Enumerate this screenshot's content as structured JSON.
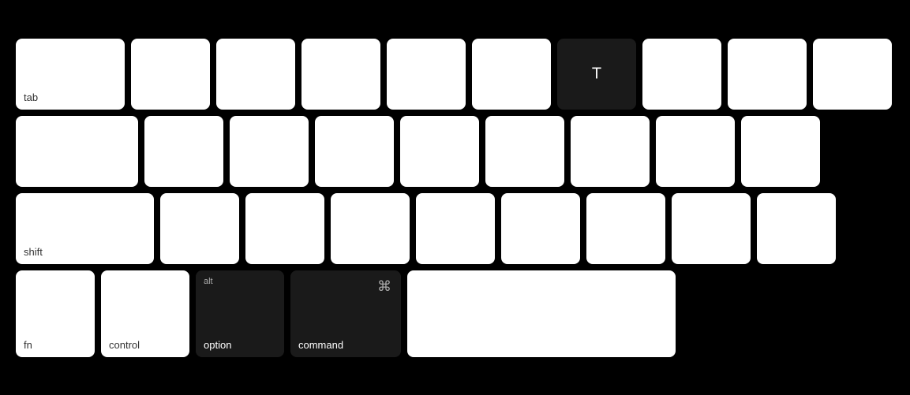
{
  "keyboard": {
    "rows": [
      {
        "id": "row1",
        "keys": [
          {
            "id": "tab",
            "label": "tab",
            "variant": "light",
            "size": "tab"
          },
          {
            "id": "r1k2",
            "label": "",
            "variant": "light",
            "size": "normal"
          },
          {
            "id": "r1k3",
            "label": "",
            "variant": "light",
            "size": "normal"
          },
          {
            "id": "r1k4",
            "label": "",
            "variant": "light",
            "size": "normal"
          },
          {
            "id": "r1k5",
            "label": "",
            "variant": "light",
            "size": "normal"
          },
          {
            "id": "r1k6",
            "label": "",
            "variant": "light",
            "size": "normal"
          },
          {
            "id": "T",
            "label": "T",
            "variant": "dark",
            "size": "normal"
          },
          {
            "id": "r1k8",
            "label": "",
            "variant": "light",
            "size": "normal"
          },
          {
            "id": "r1k9",
            "label": "",
            "variant": "light",
            "size": "normal"
          },
          {
            "id": "r1k10",
            "label": "",
            "variant": "light",
            "size": "normal"
          }
        ]
      },
      {
        "id": "row2",
        "keys": [
          {
            "id": "caps",
            "label": "",
            "variant": "light",
            "size": "caps"
          },
          {
            "id": "r2k2",
            "label": "",
            "variant": "light",
            "size": "normal"
          },
          {
            "id": "r2k3",
            "label": "",
            "variant": "light",
            "size": "normal"
          },
          {
            "id": "r2k4",
            "label": "",
            "variant": "light",
            "size": "normal"
          },
          {
            "id": "r2k5",
            "label": "",
            "variant": "light",
            "size": "normal"
          },
          {
            "id": "r2k6",
            "label": "",
            "variant": "light",
            "size": "normal"
          },
          {
            "id": "r2k7",
            "label": "",
            "variant": "light",
            "size": "normal"
          },
          {
            "id": "r2k8",
            "label": "",
            "variant": "light",
            "size": "normal"
          },
          {
            "id": "r2k9",
            "label": "",
            "variant": "light",
            "size": "normal"
          }
        ]
      },
      {
        "id": "row3",
        "keys": [
          {
            "id": "shift",
            "label": "shift",
            "variant": "light",
            "size": "shift"
          },
          {
            "id": "r3k2",
            "label": "",
            "variant": "light",
            "size": "normal"
          },
          {
            "id": "r3k3",
            "label": "",
            "variant": "light",
            "size": "normal"
          },
          {
            "id": "r3k4",
            "label": "",
            "variant": "light",
            "size": "normal"
          },
          {
            "id": "r3k5",
            "label": "",
            "variant": "light",
            "size": "normal"
          },
          {
            "id": "r3k6",
            "label": "",
            "variant": "light",
            "size": "normal"
          },
          {
            "id": "r3k7",
            "label": "",
            "variant": "light",
            "size": "normal"
          },
          {
            "id": "r3k8",
            "label": "",
            "variant": "light",
            "size": "normal"
          },
          {
            "id": "r3k9",
            "label": "",
            "variant": "light",
            "size": "normal"
          }
        ]
      },
      {
        "id": "row4",
        "keys": [
          {
            "id": "fn",
            "label": "fn",
            "variant": "light",
            "size": "fn"
          },
          {
            "id": "control",
            "label": "control",
            "variant": "light",
            "size": "control"
          },
          {
            "id": "alt",
            "topLabel": "alt",
            "label": "option",
            "variant": "dark",
            "size": "alt"
          },
          {
            "id": "command",
            "topLabel": "⌘",
            "label": "command",
            "variant": "dark",
            "size": "command"
          },
          {
            "id": "space",
            "label": "",
            "variant": "light",
            "size": "space"
          }
        ]
      }
    ]
  }
}
